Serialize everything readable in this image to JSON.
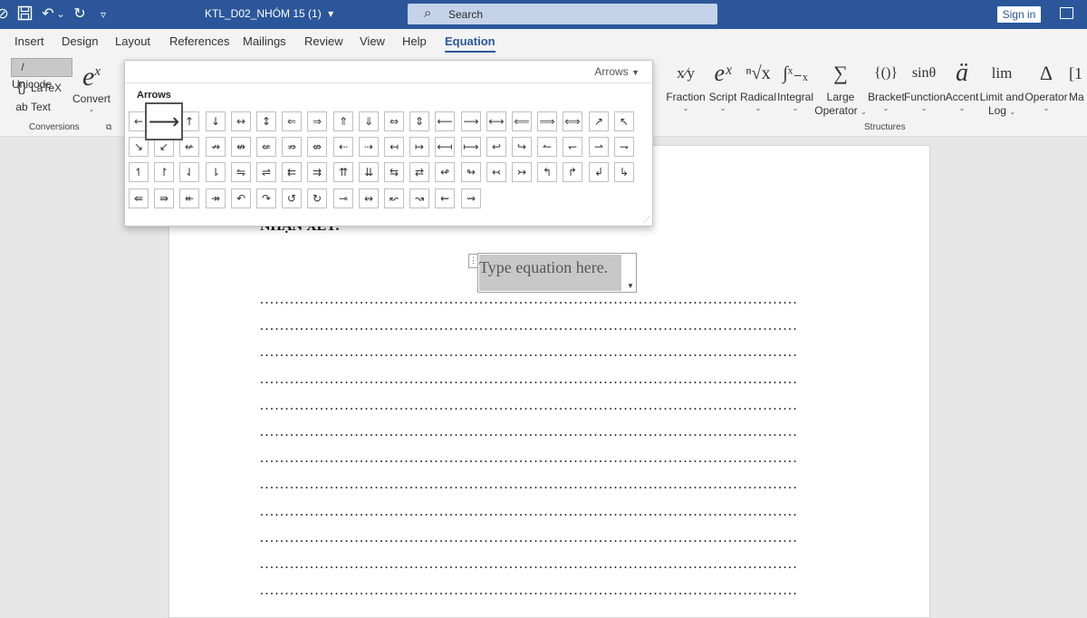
{
  "titlebar": {
    "doc_title": "KTL_D02_NHÓM 15 (1)",
    "title_dropdown": "▾",
    "search_placeholder": "Search",
    "sign_in": "Sign in",
    "qat": {
      "autosave": "⊘",
      "save": "💾",
      "undo": "↶",
      "undo_more": "⌄",
      "redo": "↻",
      "customize": "▿"
    }
  },
  "menu": {
    "tabs": [
      "Insert",
      "Design",
      "Layout",
      "References",
      "Mailings",
      "Review",
      "View",
      "Help",
      "Equation"
    ],
    "active": "Equation"
  },
  "ribbon": {
    "conversions": {
      "unicode": "Unicode",
      "latex": "LaTeX",
      "text": "Text",
      "convert": "Convert",
      "group_label": "Conversions",
      "icons": {
        "unicode": "/",
        "latex": "{}",
        "text": "ab"
      }
    },
    "structures": {
      "group_label": "Structures",
      "items": [
        {
          "label": "Fraction",
          "glyph": "x⁄y"
        },
        {
          "label": "Script",
          "glyph": "eˣ"
        },
        {
          "label": "Radical",
          "glyph": "ⁿ√x"
        },
        {
          "label": "Integral",
          "glyph": "∫ˣ₋ₓ"
        },
        {
          "label": "Large",
          "label2": "Operator",
          "glyph": "∑"
        },
        {
          "label": "Bracket",
          "glyph": "{()}"
        },
        {
          "label": "Function",
          "glyph": "sinθ"
        },
        {
          "label": "Accent",
          "glyph": "ä"
        },
        {
          "label": "Limit and",
          "label2": "Log",
          "glyph": "lim"
        },
        {
          "label": "Operator",
          "glyph": "Δ"
        },
        {
          "label": "Ma",
          "glyph": "[1"
        }
      ]
    }
  },
  "gallery": {
    "selector": "Arrows",
    "title": "Arrows",
    "rows": [
      [
        "←",
        "⟶",
        "↑",
        "↓",
        "↔",
        "↕",
        "⇐",
        "⇒",
        "⇑",
        "⇓",
        "⇔",
        "⇕",
        "⟵",
        "⟶",
        "⟷",
        "⟸",
        "⟹",
        "⟺",
        "↗",
        "↖"
      ],
      [
        "↘",
        "↙",
        "↚",
        "↛",
        "↮",
        "⇍",
        "⇏",
        "⇎",
        "⇠",
        "⇢",
        "↤",
        "↦",
        "⟻",
        "⟼",
        "↩",
        "↪",
        "↼",
        "↽",
        "⇀",
        "⇁"
      ],
      [
        "↿",
        "↾",
        "⇃",
        "⇂",
        "⇋",
        "⇌",
        "⇇",
        "⇉",
        "⇈",
        "⇊",
        "⇆",
        "⇄",
        "↫",
        "↬",
        "↢",
        "↣",
        "↰",
        "↱",
        "↲",
        "↳"
      ],
      [
        "⇚",
        "⇛",
        "↞",
        "↠",
        "↶",
        "↷",
        "↺",
        "↻",
        "⊸",
        "↭",
        "↜",
        "↝",
        "⇜",
        "⇝"
      ]
    ],
    "focused_symbol": "⟶"
  },
  "document": {
    "heading": "NHẬN XÉT:",
    "equation_placeholder": "Type equation here.",
    "dotted_line": "............................................................................................................",
    "dotted_line_count": 12
  },
  "colors": {
    "brand": "#2b579a",
    "ribbon": "#f3f3f3",
    "canvas": "#e6e6e6"
  }
}
